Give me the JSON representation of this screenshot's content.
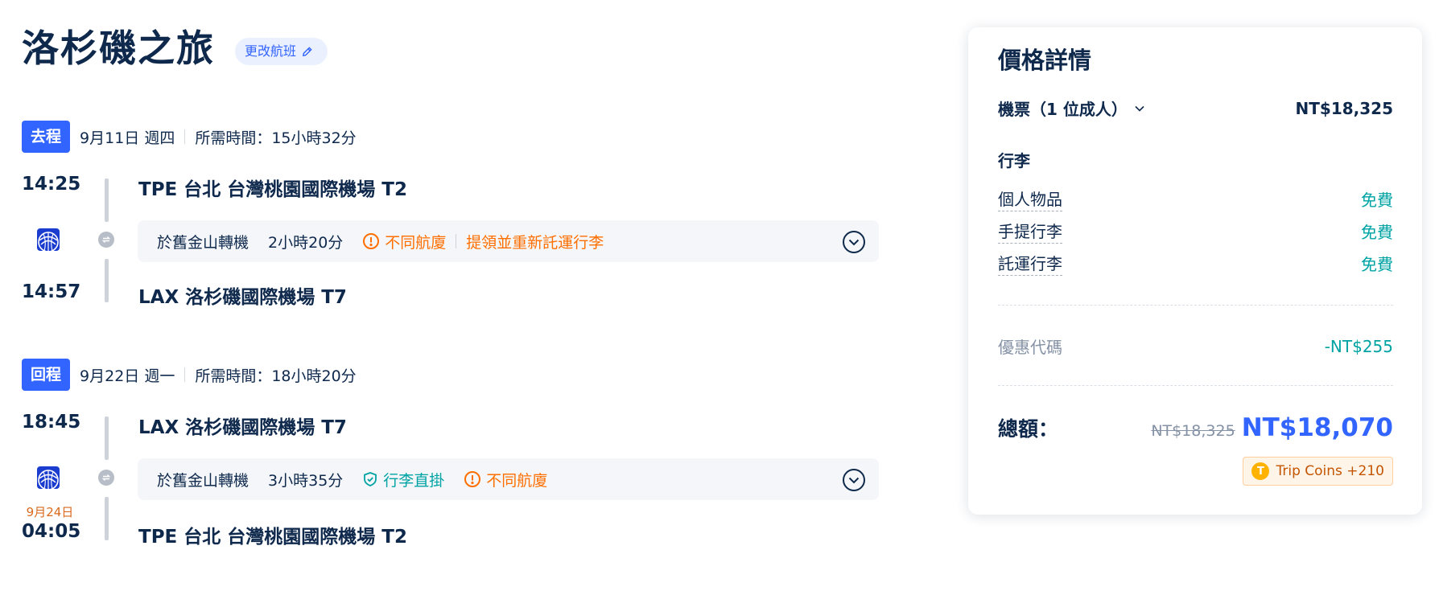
{
  "header": {
    "title": "洛杉磯之旅",
    "change_flight": "更改航班"
  },
  "outbound": {
    "badge": "去程",
    "date": "9月11日 週四",
    "duration": "所需時間：15小時32分",
    "depart_time": "14:25",
    "depart_airport": "TPE 台北 台灣桃園國際機場 T2",
    "transfer_city": "於舊金山轉機",
    "transfer_duration": "2小時20分",
    "warning": "不同航廈",
    "recheck": "提領並重新託運行李",
    "arrive_time": "14:57",
    "arrive_airport": "LAX 洛杉磯國際機場 T7"
  },
  "return": {
    "badge": "回程",
    "date": "9月22日 週一",
    "duration": "所需時間：18小時20分",
    "depart_time": "18:45",
    "depart_airport": "LAX 洛杉磯國際機場 T7",
    "transfer_city": "於舊金山轉機",
    "transfer_duration": "3小時35分",
    "through": "行李直掛",
    "warning": "不同航廈",
    "arrive_next_day": "9月24日",
    "arrive_time": "04:05",
    "arrive_airport": "TPE 台北 台灣桃園國際機場 T2"
  },
  "price": {
    "title": "價格詳情",
    "ticket_label": "機票（1 位成人）",
    "ticket_price": "NT$18,325",
    "baggage_title": "行李",
    "baggage": [
      {
        "label": "個人物品",
        "value": "免費"
      },
      {
        "label": "手提行李",
        "value": "免費"
      },
      {
        "label": "託運行李",
        "value": "免費"
      }
    ],
    "promo_label": "優惠代碼",
    "promo_value": "-NT$255",
    "total_label": "總額：",
    "old_total": "NT$18,325",
    "total": "NT$18,070",
    "coins": "Trip Coins +210"
  },
  "colors": {
    "accent": "#3264ff",
    "warning": "#ff6f00",
    "success": "#00a3a3",
    "text": "#0f294d"
  }
}
